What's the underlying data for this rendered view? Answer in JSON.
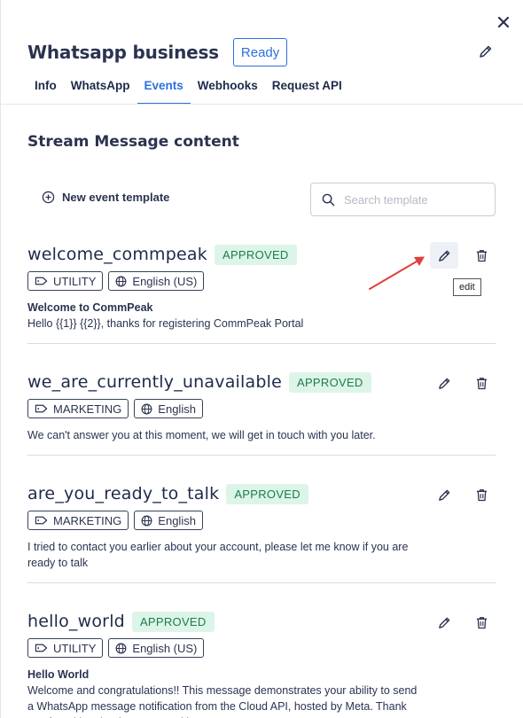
{
  "header": {
    "title": "Whatsapp business",
    "status": "Ready"
  },
  "tabs": [
    {
      "label": "Info",
      "active": false
    },
    {
      "label": "WhatsApp",
      "active": false
    },
    {
      "label": "Events",
      "active": true
    },
    {
      "label": "Webhooks",
      "active": false
    },
    {
      "label": "Request API",
      "active": false
    }
  ],
  "section": {
    "title": "Stream Message content",
    "new_template_label": "New event template",
    "search_placeholder": "Search template"
  },
  "templates": [
    {
      "name": "welcome_commpeak",
      "status": "APPROVED",
      "category": "UTILITY",
      "language": "English (US)",
      "header": "Welcome to CommPeak",
      "body": "Hello {{1}} {{2}}, thanks for registering CommPeak Portal"
    },
    {
      "name": "we_are_currently_unavailable",
      "status": "APPROVED",
      "category": "MARKETING",
      "language": "English",
      "body": "We can't answer you at this moment, we will get in touch with you later."
    },
    {
      "name": "are_you_ready_to_talk",
      "status": "APPROVED",
      "category": "MARKETING",
      "language": "English",
      "body": "I tried to contact you earlier about your account, please let me know if you are ready to talk"
    },
    {
      "name": "hello_world",
      "status": "APPROVED",
      "category": "UTILITY",
      "language": "English (US)",
      "header": "Hello World",
      "body": "Welcome and congratulations!! This message demonstrates your ability to send a WhatsApp message notification from the Cloud API, hosted by Meta. Thank you for taking the time to test with us."
    }
  ],
  "tooltip": {
    "text": "edit"
  },
  "colors": {
    "accent": "#2f6fe0",
    "approved_bg": "#dcf5e8",
    "approved_text": "#1f7a4c",
    "annotation_arrow": "#e0403a"
  }
}
